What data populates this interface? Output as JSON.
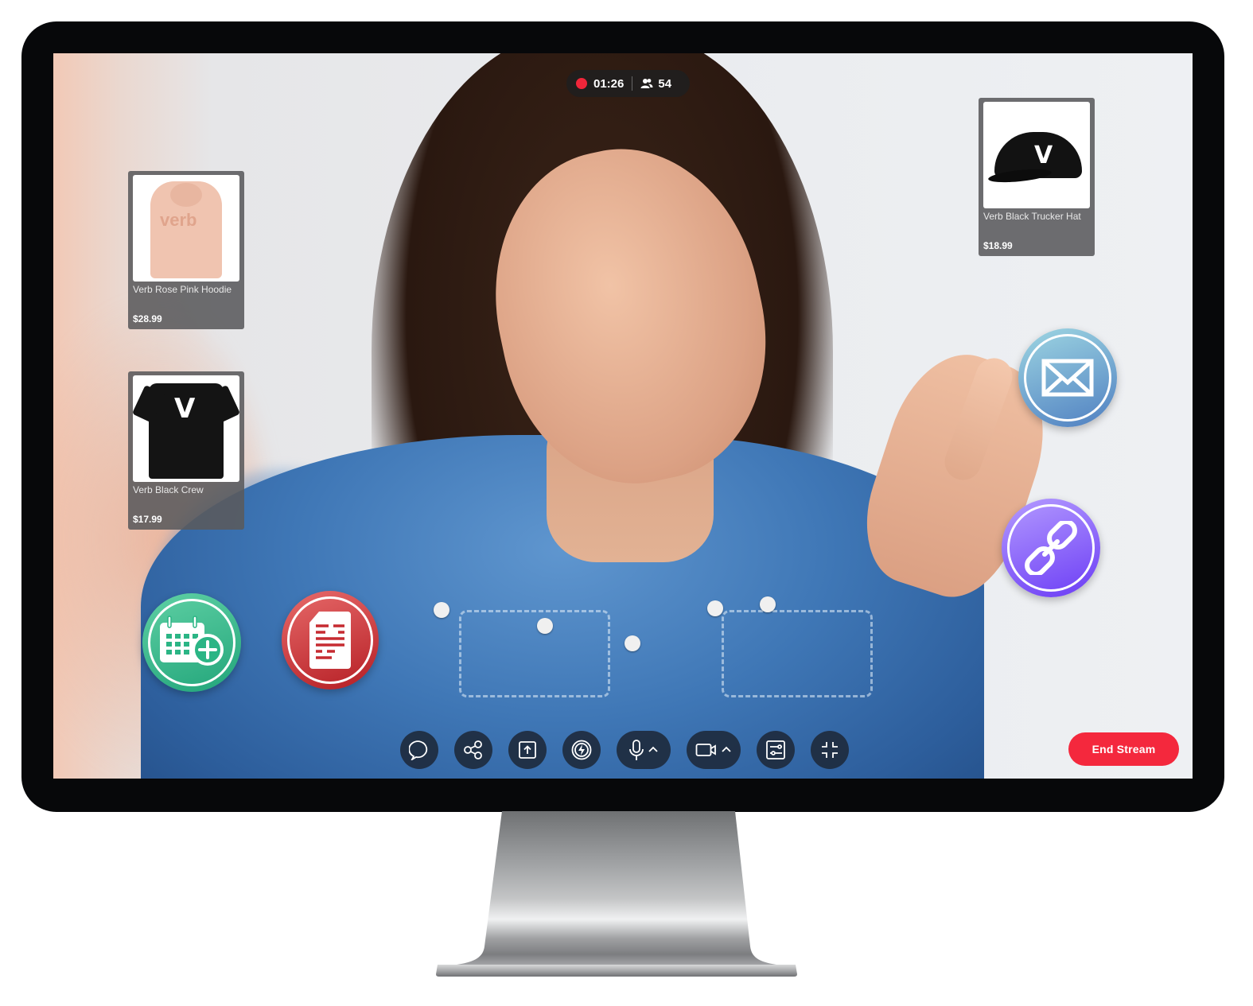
{
  "stream": {
    "recording_indicator": "recording",
    "elapsed_time": "01:26",
    "viewer_count": "54"
  },
  "products": [
    {
      "name": "Verb Rose Pink Hoodie",
      "price": "$28.99",
      "image": "rose-pink-hoodie",
      "logo_text": "verb"
    },
    {
      "name": "Verb Black Crew",
      "price": "$17.99",
      "image": "black-crew-tshirt",
      "logo_text": "V"
    },
    {
      "name": "Verb Black Trucker Hat",
      "price": "$18.99",
      "image": "black-trucker-hat",
      "logo_text": "V"
    }
  ],
  "action_buttons": [
    {
      "id": "calendar-add",
      "icon": "calendar-plus-icon",
      "color": "#2bb585"
    },
    {
      "id": "document",
      "icon": "document-icon",
      "color": "#c93035"
    },
    {
      "id": "email",
      "icon": "envelope-icon",
      "color": "#6aa3cf"
    },
    {
      "id": "link",
      "icon": "chain-link-icon",
      "color": "#7e52f7"
    }
  ],
  "controls": [
    {
      "id": "chat",
      "icon": "chat-bubble-icon"
    },
    {
      "id": "share",
      "icon": "share-icon"
    },
    {
      "id": "upload",
      "icon": "upload-icon"
    },
    {
      "id": "boost",
      "icon": "lightning-icon"
    },
    {
      "id": "microphone",
      "icon": "microphone-icon",
      "has_menu": true
    },
    {
      "id": "camera",
      "icon": "video-camera-icon",
      "has_menu": true
    },
    {
      "id": "settings",
      "icon": "sliders-icon"
    },
    {
      "id": "minimize",
      "icon": "minimize-icon"
    }
  ],
  "end_stream_label": "End Stream",
  "colors": {
    "record_red": "#f0263a",
    "end_stream_red": "#f4283d",
    "control_bg": "#1e2a3c"
  }
}
